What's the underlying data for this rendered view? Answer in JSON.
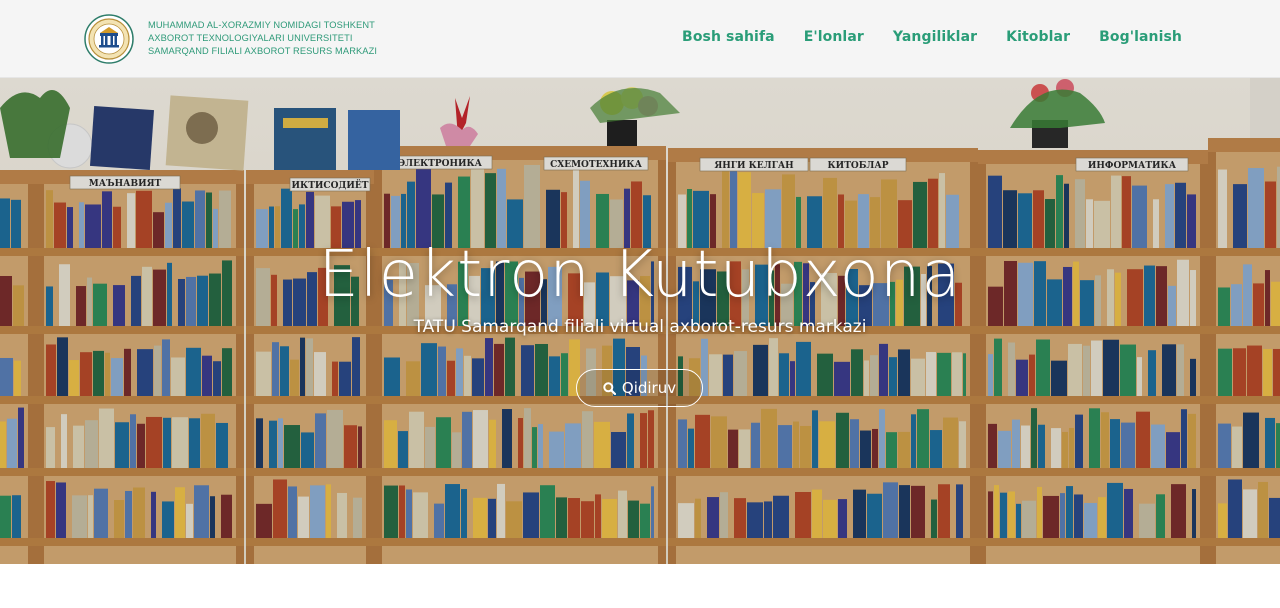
{
  "header": {
    "brand_lines": [
      "MUHAMMAD AL-XORAZMIY NOMIDAGI TOSHKENT",
      "AXBOROT TEXNOLOGIYALARI UNIVERSITETI",
      "SAMARQAND FILIALI AXBOROT RESURS MARKAZI"
    ],
    "nav": [
      {
        "label": "Bosh sahifa"
      },
      {
        "label": "E'lonlar"
      },
      {
        "label": "Yangiliklar"
      },
      {
        "label": "Kitoblar"
      },
      {
        "label": "Bog'lanish"
      }
    ]
  },
  "hero": {
    "title": "Elektron Kutubxona",
    "subtitle": "TATU Samarqand filiali virtual axborot-resurs markazi",
    "search_button": "Qidiruv",
    "search_icon": "search-icon",
    "shelf_signs": [
      "МАЪНАВИЯТ",
      "ИКТИСОДИЁТ",
      "ЭЛЕКТРОНИКА",
      "СХЕМОТЕХНИКА",
      "ЯНГИ КЕЛГАН",
      "КИТОБЛАР",
      "ИНФОРМАТИКА"
    ]
  },
  "colors": {
    "brand": "#2a9d78",
    "header_bg": "#f5f5f5",
    "wood": "#c8955c",
    "wall": "#f1ede3"
  }
}
